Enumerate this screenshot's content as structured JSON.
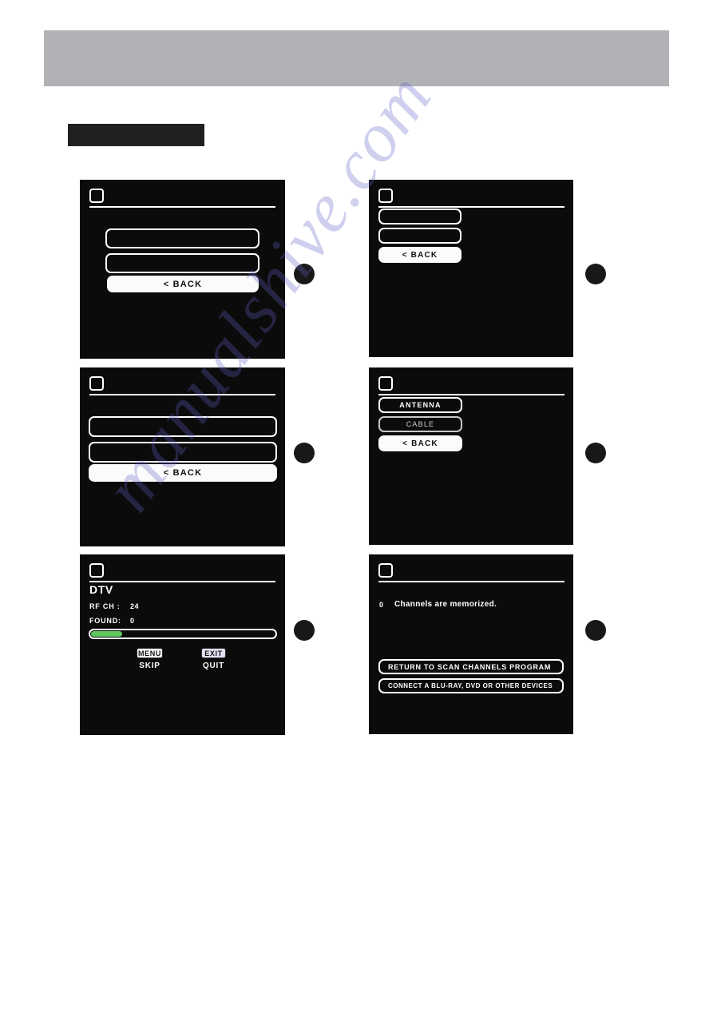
{
  "page": {
    "header_bar_color": "#b0b2b6",
    "section_label_color": "#211f20",
    "background": "#ffffff",
    "watermark_text": "manualshive.com"
  },
  "colors": {
    "screen_background": "#0c0b0b",
    "outline": "#ffffff",
    "filled_button_bg": "#fbfbfb",
    "filled_button_text": "#111111",
    "dim_text": "#cfcfcf",
    "progress_fill": "#5ec75e",
    "bullet": "#1a1718",
    "key_tint": "#e4e2f5"
  },
  "common": {
    "back_label": "< BACK",
    "screen_icon_name": "rounded-square-icon"
  },
  "panels": [
    {
      "id": "panel-1",
      "step_bullet": "",
      "options": [
        {
          "label": "",
          "style": "outline"
        },
        {
          "label": "",
          "style": "outline"
        },
        {
          "label": "< BACK",
          "style": "filled"
        }
      ]
    },
    {
      "id": "panel-2",
      "step_bullet": "",
      "options": [
        {
          "label": "",
          "style": "outline"
        },
        {
          "label": "",
          "style": "outline"
        },
        {
          "label": "< BACK",
          "style": "filled"
        }
      ]
    },
    {
      "id": "panel-3",
      "step_bullet": "",
      "options": [
        {
          "label": "",
          "style": "outline"
        },
        {
          "label": "",
          "style": "outline"
        },
        {
          "label": "< BACK",
          "style": "filled"
        }
      ]
    },
    {
      "id": "panel-4",
      "step_bullet": "",
      "options": [
        {
          "label": "ANTENNA",
          "style": "outline"
        },
        {
          "label": "CABLE",
          "style": "outline-dim"
        },
        {
          "label": "< BACK",
          "style": "filled"
        }
      ]
    },
    {
      "id": "panel-5",
      "step_bullet": "",
      "scan": {
        "title": "DTV",
        "rows": [
          {
            "label": "RF CH :",
            "value": "24"
          },
          {
            "label": "FOUND:",
            "value": "0"
          }
        ],
        "progress_percent": 17,
        "keys": [
          {
            "cap": "MENU",
            "action": "SKIP",
            "tinted": false
          },
          {
            "cap": "EXIT",
            "action": "QUIT",
            "tinted": true
          }
        ]
      }
    },
    {
      "id": "panel-6",
      "step_bullet": "",
      "result": {
        "count": "0",
        "message": "Channels are memorized.",
        "buttons": [
          "RETURN TO SCAN CHANNELS PROGRAM",
          "CONNECT A BLU-RAY, DVD OR OTHER DEVICES"
        ]
      }
    }
  ]
}
